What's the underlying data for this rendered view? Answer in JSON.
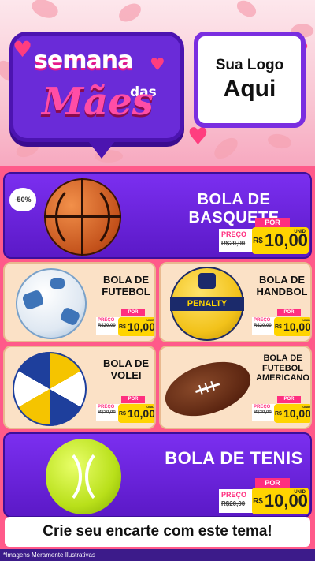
{
  "header": {
    "title_line1": "semana",
    "title_das": "das",
    "title_line2": "Mães",
    "logo_line1": "Sua Logo",
    "logo_line2": "Aqui"
  },
  "products": [
    {
      "name": "BOLA DE BASQUETE",
      "discount": "-50%",
      "por_label": "POR",
      "preco_label": "PREÇO",
      "old_price": "R$20,00",
      "currency": "R$",
      "price": "10,00",
      "unit": "UNID"
    },
    {
      "name": "BOLA DE FUTEBOL",
      "por_label": "POR",
      "preco_label": "PREÇO",
      "old_price": "R$20,00",
      "currency": "R$",
      "price": "10,00",
      "unit": "UNID"
    },
    {
      "name": "BOLA DE HANDBOL",
      "por_label": "POR",
      "preco_label": "PREÇO",
      "old_price": "R$20,00",
      "currency": "R$",
      "price": "10,00",
      "unit": "UNID"
    },
    {
      "name": "BOLA DE VOLEI",
      "por_label": "POR",
      "preco_label": "PREÇO",
      "old_price": "R$20,00",
      "currency": "R$",
      "price": "10,00",
      "unit": "UNID"
    },
    {
      "name": "BOLA DE FUTEBOL AMERICANO",
      "por_label": "POR",
      "preco_label": "PREÇO",
      "old_price": "R$20,00",
      "currency": "R$",
      "price": "10,00",
      "unit": "UNID"
    },
    {
      "name": "BOLA DE TENIS",
      "por_label": "POR",
      "preco_label": "PREÇO",
      "old_price": "R$20,00",
      "currency": "R$",
      "price": "10,00",
      "unit": "UNID"
    }
  ],
  "brand_text": {
    "penalty": "PENALTY"
  },
  "footer": {
    "cta": "Crie seu encarte com este tema!",
    "disclaimer": "*Imagens Meramente Ilustrativas"
  },
  "colors": {
    "purple": "#6a2bd8",
    "pink": "#ff2f7f",
    "yellow": "#ffd400",
    "peach": "#fbe1c6"
  }
}
